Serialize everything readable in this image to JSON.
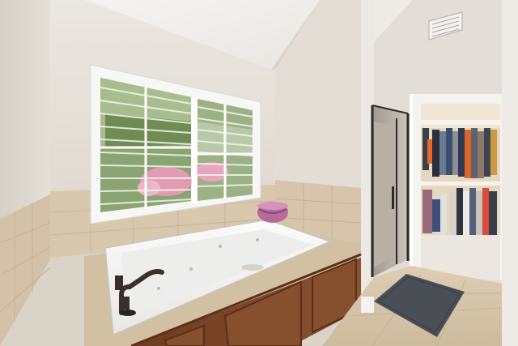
{
  "scene": {
    "kind": "photograph",
    "subject": "bathroom-with-jetted-tub-and-walk-in-closet",
    "palette": {
      "wall": "#e6e1da",
      "ceiling": "#f1efec",
      "tile": "#d8c7ae",
      "floor_tile": "#d9c9b0",
      "cabinet": "#7a4426",
      "tub": "#f6f6f4",
      "window_frame": "#ffffff",
      "foliage": "#7a9a55",
      "blossom": "#e39bb2",
      "bath_mat": "#4a4e55",
      "closet_wall": "#e4d8c2",
      "faucet": "#3a2f2a"
    },
    "icons": [
      "air-vent-icon",
      "faucet-icon"
    ]
  }
}
